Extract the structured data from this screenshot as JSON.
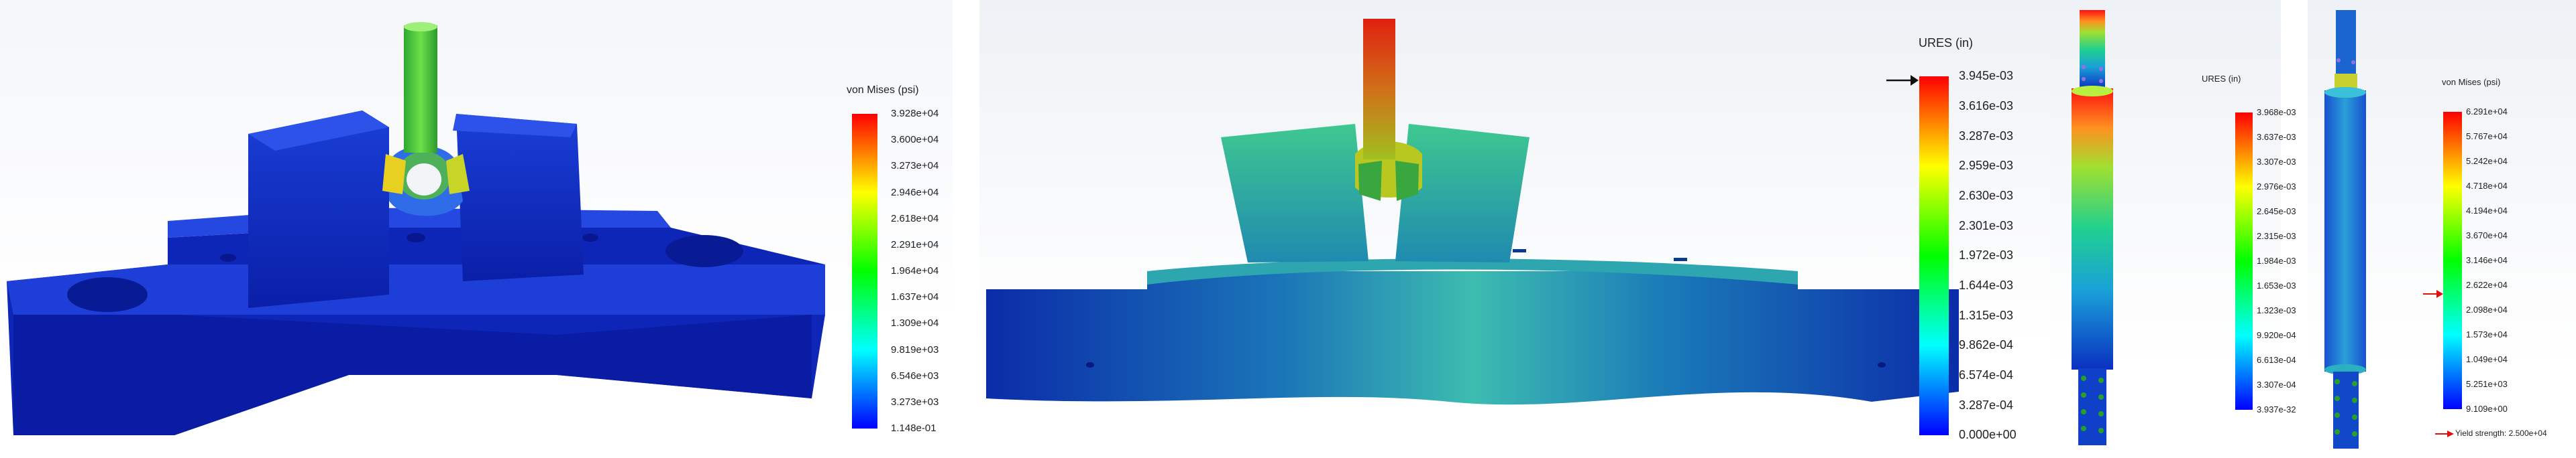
{
  "panels": [
    {
      "legend_title": "von Mises (psi)",
      "ticks": [
        "3.928e+04",
        "3.600e+04",
        "3.273e+04",
        "2.946e+04",
        "2.618e+04",
        "2.291e+04",
        "1.964e+04",
        "1.637e+04",
        "1.309e+04",
        "9.819e+03",
        "6.546e+03",
        "3.273e+03",
        "1.148e-01"
      ]
    },
    {
      "legend_title": "URES (in)",
      "ticks": [
        "3.945e-03",
        "3.616e-03",
        "3.287e-03",
        "2.959e-03",
        "2.630e-03",
        "2.301e-03",
        "1.972e-03",
        "1.644e-03",
        "1.315e-03",
        "9.862e-04",
        "6.574e-04",
        "3.287e-04",
        "0.000e+00"
      ]
    },
    {
      "legend_title": "URES (in)",
      "ticks": [
        "3.968e-03",
        "3.637e-03",
        "3.307e-03",
        "2.976e-03",
        "2.645e-03",
        "2.315e-03",
        "1.984e-03",
        "1.653e-03",
        "1.323e-03",
        "9.920e-04",
        "6.613e-04",
        "3.307e-04",
        "3.937e-32"
      ]
    },
    {
      "legend_title": "von Mises (psi)",
      "ticks": [
        "6.291e+04",
        "5.767e+04",
        "5.242e+04",
        "4.718e+04",
        "4.194e+04",
        "3.670e+04",
        "3.146e+04",
        "2.622e+04",
        "2.098e+04",
        "1.573e+04",
        "1.049e+04",
        "5.251e+03",
        "9.109e+00"
      ],
      "yield_label": "Yield strength: 2.500e+04"
    }
  ],
  "colors": {
    "scale": [
      "#ff0000",
      "#ff8000",
      "#ffff00",
      "#80ff00",
      "#00ff00",
      "#00ff80",
      "#00ffff",
      "#0080ff",
      "#0000ff"
    ],
    "arrow_red": "#e01010",
    "arrow_black": "#111111"
  }
}
